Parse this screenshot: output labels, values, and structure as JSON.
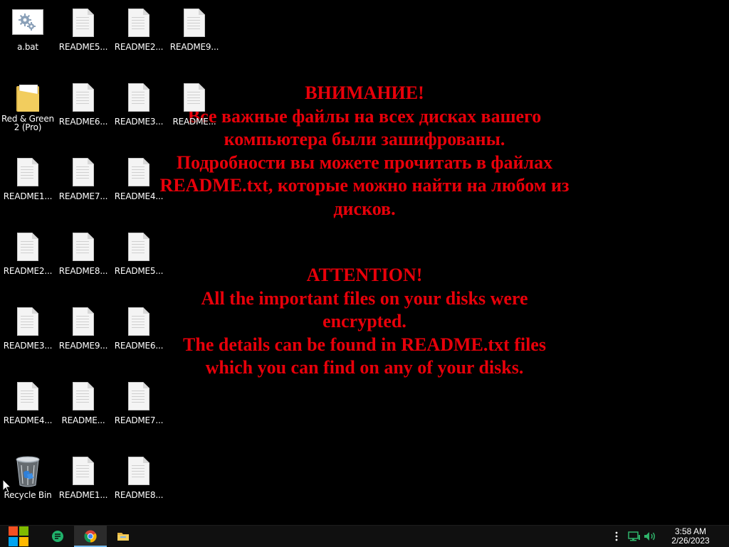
{
  "desktop": {
    "background_color": "#000000",
    "message_color": "#e8000a",
    "message_ru": [
      "ВНИМАНИЕ!",
      "Все важные файлы на всех дисках вашего",
      "компьютера были зашифрованы.",
      "Подробности вы можете прочитать в файлах",
      "README.txt, которые можно найти на любом из",
      "дисков."
    ],
    "message_en": [
      "ATTENTION!",
      "All the important files on your disks were",
      "encrypted.",
      "The details can be found in README.txt files",
      "which you can find on any of your disks."
    ],
    "icons": [
      {
        "label": "a.bat",
        "type": "bat-gear-icon"
      },
      {
        "label": "README5...",
        "type": "document-icon"
      },
      {
        "label": "README2...",
        "type": "document-icon"
      },
      {
        "label": "README9...",
        "type": "document-icon"
      },
      {
        "label": "Red & Green 2 (Pro)",
        "type": "folder-icon"
      },
      {
        "label": "README6...",
        "type": "document-icon"
      },
      {
        "label": "README3...",
        "type": "document-icon"
      },
      {
        "label": "README...",
        "type": "document-icon"
      },
      {
        "label": "README1...",
        "type": "document-icon"
      },
      {
        "label": "README7...",
        "type": "document-icon"
      },
      {
        "label": "README4...",
        "type": "document-icon"
      },
      {
        "label": "README2...",
        "type": "document-icon"
      },
      {
        "label": "README8...",
        "type": "document-icon"
      },
      {
        "label": "README5...",
        "type": "document-icon"
      },
      {
        "label": "README3...",
        "type": "document-icon"
      },
      {
        "label": "README9...",
        "type": "document-icon"
      },
      {
        "label": "README6...",
        "type": "document-icon"
      },
      {
        "label": "README4...",
        "type": "document-icon"
      },
      {
        "label": "README...",
        "type": "document-icon"
      },
      {
        "label": "README7...",
        "type": "document-icon"
      },
      {
        "label": "Recycle Bin",
        "type": "recycle-bin-icon"
      },
      {
        "label": "README1...",
        "type": "document-icon"
      },
      {
        "label": "README8...",
        "type": "document-icon"
      }
    ]
  },
  "taskbar": {
    "background_color": "#101010",
    "buttons": [
      {
        "name": "start-button",
        "icon": "windows-logo-icon"
      },
      {
        "name": "chat-button",
        "icon": "chat-app-icon"
      },
      {
        "name": "chrome-button",
        "icon": "chrome-icon"
      },
      {
        "name": "explorer-button",
        "icon": "file-explorer-icon"
      }
    ],
    "tray": {
      "icons": [
        "overflow-dots-icon",
        "network-icon",
        "volume-icon"
      ],
      "time": "3:58 AM",
      "date": "2/26/2023"
    }
  }
}
